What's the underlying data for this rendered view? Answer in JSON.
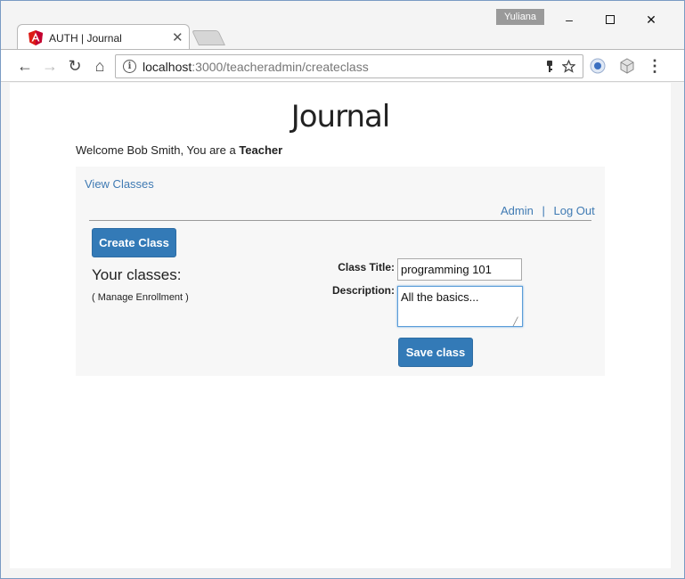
{
  "window": {
    "profile_name": "Yuliana",
    "minimize": "–",
    "maximize": "☐",
    "close": "✕"
  },
  "tab": {
    "title": "AUTH | Journal",
    "close": "✕",
    "icon": "angular-icon"
  },
  "toolbar": {
    "back": "←",
    "forward": "→",
    "reload": "↻",
    "home": "⌂",
    "url_host": "localhost",
    "url_path": ":3000/teacheradmin/createclass",
    "key_icon": "key-icon",
    "star_icon": "star-icon",
    "menu": "⋮"
  },
  "page": {
    "title": "Journal",
    "welcome_prefix": "Welcome Bob Smith, You are a ",
    "welcome_role": "Teacher",
    "view_classes": "View Classes",
    "admin": "Admin",
    "separator": "|",
    "logout": "Log Out",
    "create_class": "Create Class",
    "your_classes": "Your classes:",
    "manage_enrollment": "( Manage Enrollment )"
  },
  "form": {
    "title_label": "Class Title:",
    "title_value": "programming 101",
    "description_label": "Description:",
    "description_value": "All the basics...",
    "save_label": "Save class"
  },
  "colors": {
    "primary_button": "#337ab7",
    "link": "#3f7ab3",
    "panel_bg": "#f7f7f7"
  }
}
